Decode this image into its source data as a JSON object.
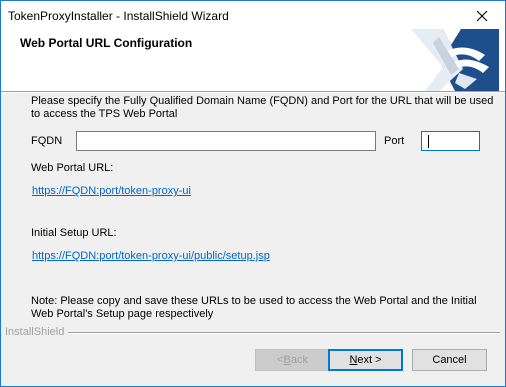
{
  "window": {
    "title": "TokenProxyInstaller - InstallShield Wizard"
  },
  "header": {
    "title": "Web Portal URL Configuration"
  },
  "form": {
    "instructions": "Please specify the Fully Qualified Domain Name (FQDN) and Port for the URL that will be used to access the TPS Web Portal",
    "fqdn_label": "FQDN",
    "fqdn_value": "",
    "port_label": "Port",
    "port_value": ""
  },
  "urls": {
    "web_portal_label": "Web Portal URL:",
    "web_portal_link": "https://FQDN:port/token-proxy-ui",
    "initial_setup_label": "Initial Setup URL:",
    "initial_setup_link": "https://FQDN:port/token-proxy-ui/public/setup.jsp"
  },
  "note": "Note: Please copy and save these URLs to be used to access the Web Portal and the Initial Web Portal's Setup page respectively",
  "footer": {
    "brand": "InstallShield",
    "back_mnemonic": "B",
    "back_rest": "ack",
    "back_prefix": "< ",
    "next_mnemonic": "N",
    "next_rest": "ext >",
    "cancel_label": "Cancel"
  },
  "colors": {
    "accent": "#0078d7",
    "link": "#0066cc",
    "panel": "#f0f0f0"
  },
  "icons": {
    "close": "close-icon",
    "logo": "installshield-logo"
  }
}
